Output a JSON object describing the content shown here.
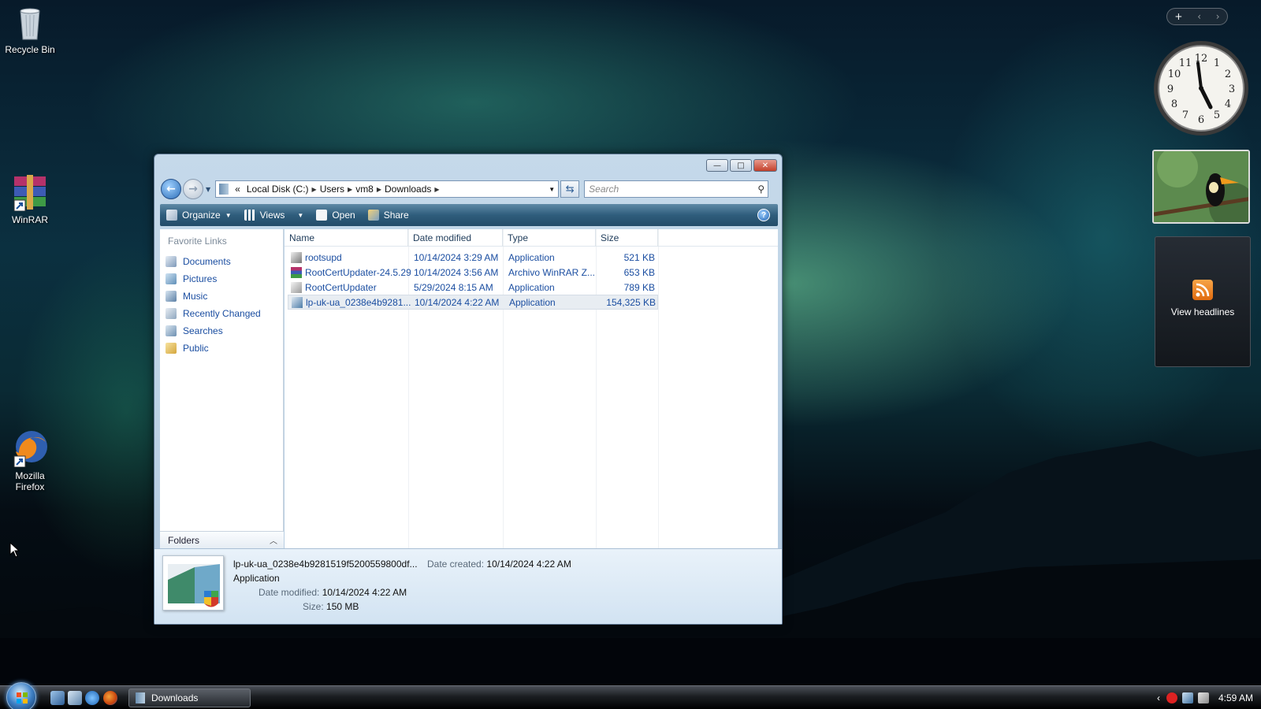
{
  "desktop": {
    "icons": [
      {
        "label": "Recycle Bin"
      },
      {
        "label": "WinRAR"
      },
      {
        "label_line1": "Mozilla",
        "label_line2": "Firefox"
      }
    ]
  },
  "gadgets": {
    "controls": {
      "add": "+",
      "prev": "‹",
      "next": "›"
    },
    "feed_label": "View headlines",
    "clock_numbers": [
      "12",
      "1",
      "2",
      "3",
      "4",
      "5",
      "6",
      "7",
      "8",
      "9",
      "10",
      "11"
    ]
  },
  "window": {
    "caption": {
      "minimize": "—",
      "maximize": "□",
      "close": "✕"
    },
    "address": {
      "overflow": "«",
      "crumbs": [
        "Local Disk (C:)",
        "Users",
        "vm8",
        "Downloads"
      ]
    },
    "search_placeholder": "Search",
    "toolbar": {
      "organize": "Organize",
      "views": "Views",
      "open": "Open",
      "share": "Share",
      "help": "?"
    },
    "favorites": {
      "header": "Favorite Links",
      "items": [
        "Documents",
        "Pictures",
        "Music",
        "Recently Changed",
        "Searches",
        "Public"
      ]
    },
    "folders_label": "Folders",
    "columns": {
      "name": "Name",
      "date": "Date modified",
      "type": "Type",
      "size": "Size"
    },
    "files": [
      {
        "name": "rootsupd",
        "date": "10/14/2024 3:29 AM",
        "type": "Application",
        "size": "521 KB"
      },
      {
        "name": "RootCertUpdater-24.5.29",
        "date": "10/14/2024 3:56 AM",
        "type": "Archivo WinRAR Z...",
        "size": "653 KB"
      },
      {
        "name": "RootCertUpdater",
        "date": "5/29/2024 8:15 AM",
        "type": "Application",
        "size": "789 KB"
      },
      {
        "name": "lp-uk-ua_0238e4b9281...",
        "date": "10/14/2024 4:22 AM",
        "type": "Application",
        "size": "154,325 KB"
      }
    ],
    "details": {
      "filename": "lp-uk-ua_0238e4b9281519f5200559800df...",
      "type": "Application",
      "created_label": "Date created:",
      "created_value": "10/14/2024 4:22 AM",
      "modified_label": "Date modified:",
      "modified_value": "10/14/2024 4:22 AM",
      "size_label": "Size:",
      "size_value": "150 MB"
    }
  },
  "taskbar": {
    "task_label": "Downloads",
    "clock": "4:59 AM",
    "tray_expand": "‹"
  }
}
